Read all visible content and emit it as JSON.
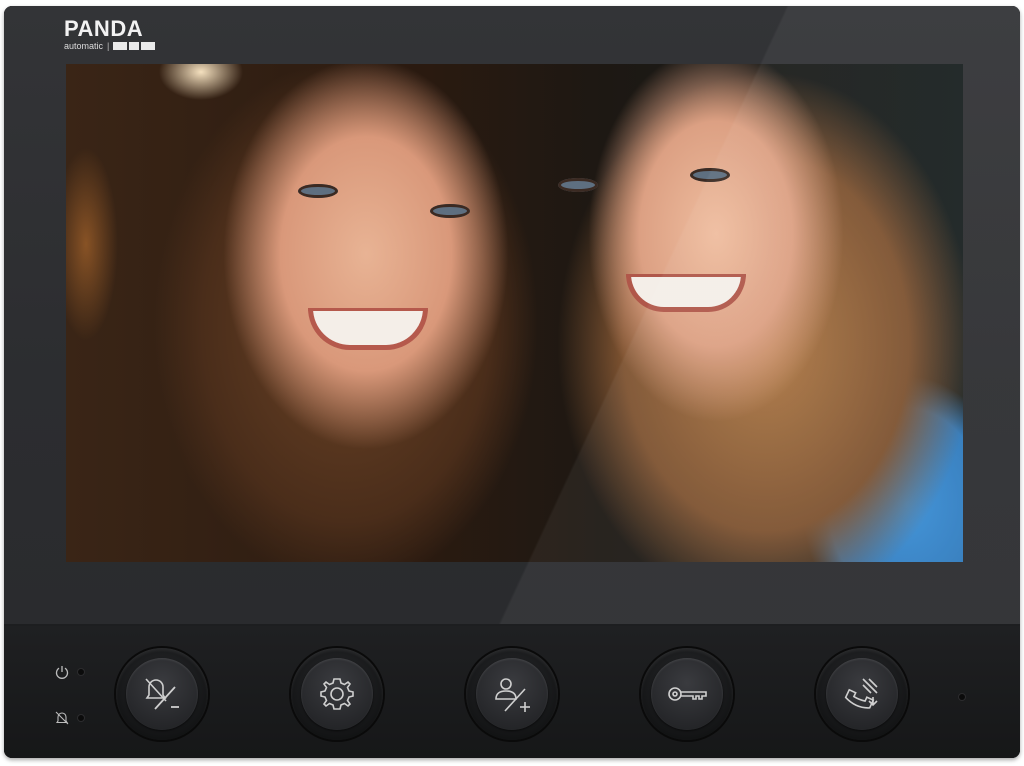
{
  "brand": {
    "name": "PANDA",
    "tagline": "automatic"
  },
  "screen": {
    "content": "camera-view"
  },
  "indicators": [
    {
      "icon": "power-icon",
      "state": "off"
    },
    {
      "icon": "bell-muted-icon",
      "state": "off"
    }
  ],
  "buttons": [
    {
      "icon": "mute-minus-icon"
    },
    {
      "icon": "settings-gear-icon"
    },
    {
      "icon": "contact-add-icon"
    },
    {
      "icon": "door-key-icon"
    },
    {
      "icon": "handset-transfer-icon"
    }
  ],
  "colors": {
    "device_body": "#2a2b2d",
    "panel": "#1a1b1d",
    "icon_stroke": "#cfcfcf",
    "logo_text": "#f2f2f2"
  }
}
